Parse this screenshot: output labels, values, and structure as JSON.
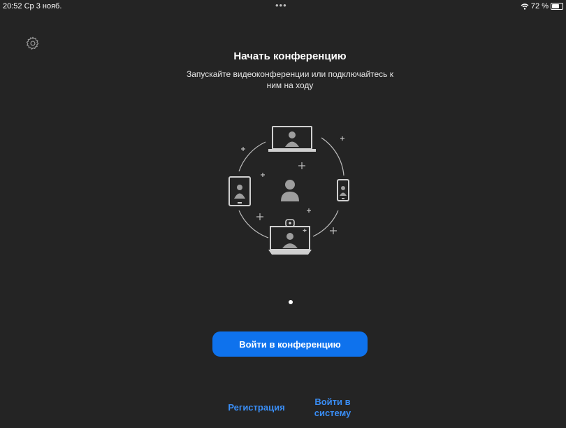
{
  "status_bar": {
    "time_date": "20:52  Ср 3 нояб.",
    "dots": "•••",
    "battery": "72 %"
  },
  "hero": {
    "title": "Начать конференцию",
    "subtitle": "Запускайте видеоконференции или подключайтесь к ним на ходу"
  },
  "actions": {
    "join_label": "Войти в конференцию",
    "signup_label": "Регистрация",
    "signin_label": "Войти в\nсистему"
  },
  "pager": {
    "current": 1,
    "total": 1
  },
  "colors": {
    "background": "#242424",
    "accent": "#0e72ed",
    "link": "#3a8ef6"
  },
  "icons": {
    "settings": "gear-icon",
    "wifi": "wifi-icon",
    "battery": "battery-icon"
  }
}
